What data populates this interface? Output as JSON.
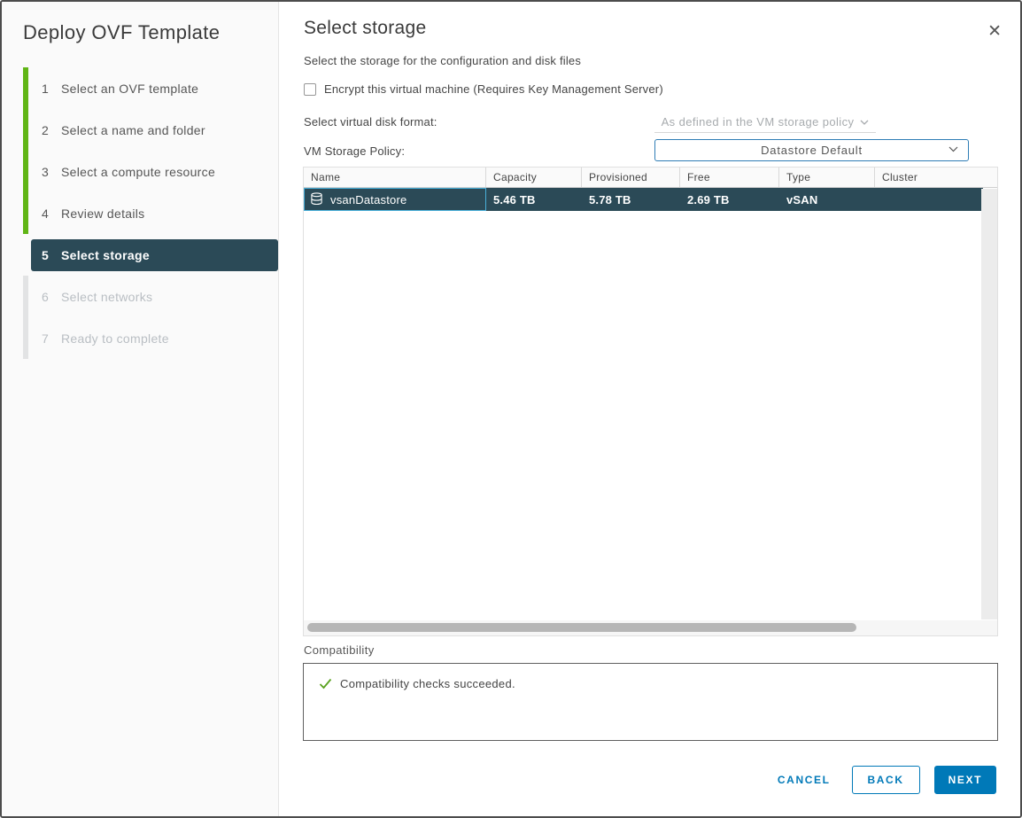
{
  "dialog": {
    "title": "Deploy OVF Template",
    "close_icon": "✕"
  },
  "sidebar": {
    "steps": [
      {
        "num": "1",
        "label": "Select an OVF template",
        "state": "done"
      },
      {
        "num": "2",
        "label": "Select a name and folder",
        "state": "done"
      },
      {
        "num": "3",
        "label": "Select a compute resource",
        "state": "done"
      },
      {
        "num": "4",
        "label": "Review details",
        "state": "done"
      },
      {
        "num": "5",
        "label": "Select storage",
        "state": "active"
      },
      {
        "num": "6",
        "label": "Select networks",
        "state": "future"
      },
      {
        "num": "7",
        "label": "Ready to complete",
        "state": "future"
      }
    ]
  },
  "main": {
    "title": "Select storage",
    "subtitle": "Select the storage for the configuration and disk files",
    "encrypt_checkbox": {
      "label": "Encrypt this virtual machine (Requires Key Management Server)",
      "checked": false
    },
    "disk_format": {
      "label": "Select virtual disk format:",
      "value": "As defined in the VM storage policy",
      "disabled": true
    },
    "storage_policy": {
      "label": "VM Storage Policy:",
      "value": "Datastore Default"
    },
    "table": {
      "columns": [
        "Name",
        "Capacity",
        "Provisioned",
        "Free",
        "Type",
        "Cluster"
      ],
      "rows": [
        {
          "name": "vsanDatastore",
          "capacity": "5.46 TB",
          "provisioned": "5.78 TB",
          "free": "2.69 TB",
          "type": "vSAN",
          "cluster": "",
          "selected": true
        }
      ]
    },
    "compatibility": {
      "label": "Compatibility",
      "message": "Compatibility checks succeeded."
    }
  },
  "footer": {
    "cancel": "CANCEL",
    "back": "BACK",
    "next": "NEXT"
  },
  "colors": {
    "accent_blue": "#0079b8",
    "step_green": "#60b515",
    "active_dark": "#2b4a57",
    "selection_border": "#49afd9",
    "success_green": "#5aa220"
  }
}
